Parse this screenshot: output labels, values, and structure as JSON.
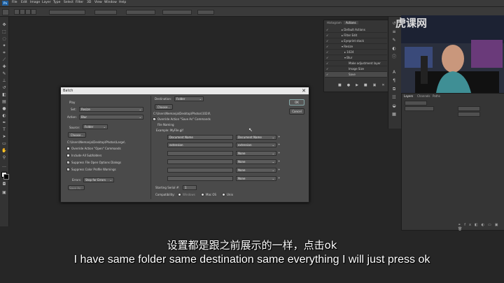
{
  "app_logo": "Ps",
  "menu": [
    "File",
    "Edit",
    "Image",
    "Layer",
    "Type",
    "Select",
    "Filter",
    "3D",
    "View",
    "Window",
    "Help"
  ],
  "watermark": "虎课网",
  "actions_panel": {
    "tabs": [
      "Histogram",
      "Actions"
    ],
    "items": [
      "Default Actions",
      "Filter Edit",
      "Eyeprint stack",
      "Resize",
      "1024",
      "Blur",
      "Make adjustment layer",
      "Image Size",
      "Save"
    ]
  },
  "layers_panel": {
    "tabs": [
      "Layers",
      "Channels",
      "Paths"
    ]
  },
  "dialog": {
    "title": "Batch",
    "play_label": "Play",
    "set_label": "Set:",
    "set_value": "Resize",
    "action_label": "Action:",
    "action_value": "Blur",
    "source_label": "Source:",
    "source_value": "Folder",
    "choose_label": "Choose...",
    "source_path": "C:\\Users\\Nemanja\\Desktop\\Photos\\Large\\",
    "source_options": [
      "Override Action \"Open\" Commands",
      "Include All Subfolders",
      "Suppress File Open Options Dialogs",
      "Suppress Color Profile Warnings"
    ],
    "source_checked": [
      false,
      false,
      true,
      true
    ],
    "errors_label": "Errors:",
    "errors_value": "Stop for Errors",
    "save_as_label": "Save As...",
    "destination_label": "Destination:",
    "destination_value": "Folder",
    "dest_choose_label": "Choose...",
    "dest_path": "C:\\Users\\Nemanja\\Desktop\\Photos\\1024\\",
    "override_save_label": "Override Action \"Save As\" Commands",
    "file_naming_label": "File Naming",
    "example_label": "Example: MyFile.gif",
    "naming_rows": [
      {
        "left": "Document Name",
        "right": "Document Name"
      },
      {
        "left": "extension",
        "right": "extension"
      },
      {
        "left": "",
        "right": "None"
      },
      {
        "left": "",
        "right": "None"
      },
      {
        "left": "",
        "right": "None"
      },
      {
        "left": "",
        "right": "None"
      }
    ],
    "serial_label": "Starting Serial #:",
    "serial_value": "1",
    "compat_label": "Compatibility:",
    "compat_options": [
      "Windows",
      "Mac OS",
      "Unix"
    ],
    "ok_label": "OK",
    "cancel_label": "Cancel"
  },
  "subtitles": {
    "zh": "设置都是跟之前展示的一样，点击ok",
    "en": "I have same folder same destination same everything I will just press ok"
  }
}
